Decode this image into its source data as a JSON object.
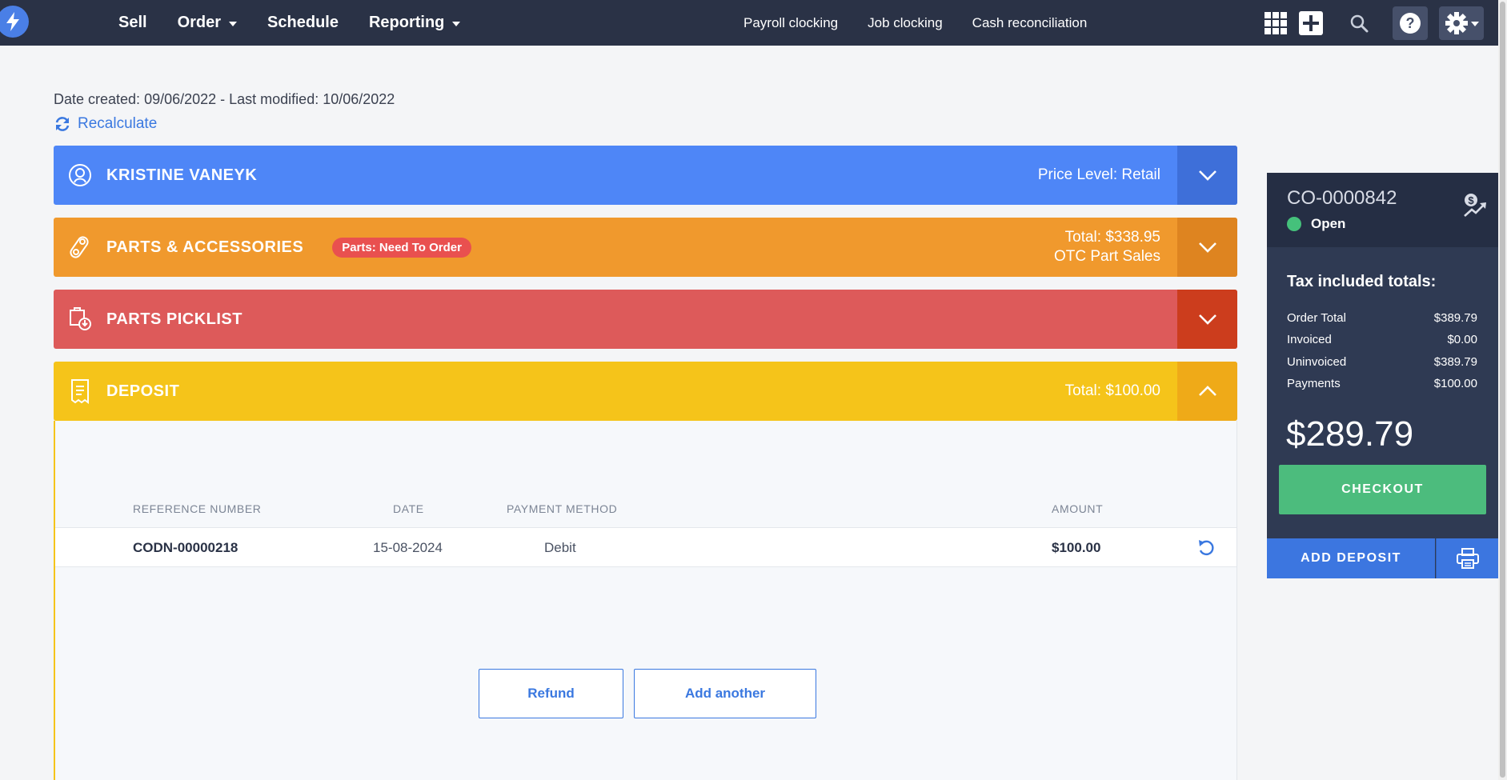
{
  "nav": {
    "main": [
      {
        "label": "Sell",
        "dropdown": false
      },
      {
        "label": "Order",
        "dropdown": true
      },
      {
        "label": "Schedule",
        "dropdown": false
      },
      {
        "label": "Reporting",
        "dropdown": true
      }
    ],
    "secondary": [
      "Payroll clocking",
      "Job clocking",
      "Cash reconciliation"
    ],
    "icons": [
      "apps-grid-icon",
      "plus-icon",
      "search-icon",
      "help-icon",
      "gear-icon"
    ]
  },
  "order": {
    "meta": "Date created: 09/06/2022 - Last modified: 10/06/2022",
    "recalculate": "Recalculate"
  },
  "panels": {
    "customer": {
      "title": "KRISTINE VANEYK",
      "right": "Price Level: Retail",
      "color": "#4e86f7"
    },
    "parts": {
      "title": "PARTS & ACCESSORIES",
      "badge": "Parts: Need To Order",
      "total": "Total: $338.95",
      "sub": "OTC Part Sales",
      "color": "#f0992d"
    },
    "picklist": {
      "title": "PARTS PICKLIST",
      "color": "#dd5a5a"
    },
    "deposit": {
      "title": "DEPOSIT",
      "right": "Total: $100.00",
      "color": "#f5c41a"
    }
  },
  "deposit_table": {
    "headers": {
      "ref": "REFERENCE NUMBER",
      "date": "DATE",
      "method": "PAYMENT METHOD",
      "amount": "AMOUNT"
    },
    "rows": [
      {
        "ref": "CODN-00000218",
        "date": "15-08-2024",
        "method": "Debit",
        "amount": "$100.00"
      }
    ],
    "refund_label": "Refund",
    "add_another_label": "Add another"
  },
  "summary": {
    "order_number": "CO-0000842",
    "status": "Open",
    "title": "Tax included totals:",
    "rows": [
      {
        "label": "Order Total",
        "value": "$389.79"
      },
      {
        "label": "Invoiced",
        "value": "$0.00"
      },
      {
        "label": "Uninvoiced",
        "value": "$389.79"
      },
      {
        "label": "Payments",
        "value": "$100.00"
      }
    ],
    "balance": "$289.79",
    "checkout_label": "CHECKOUT",
    "add_deposit_label": "ADD DEPOSIT"
  }
}
